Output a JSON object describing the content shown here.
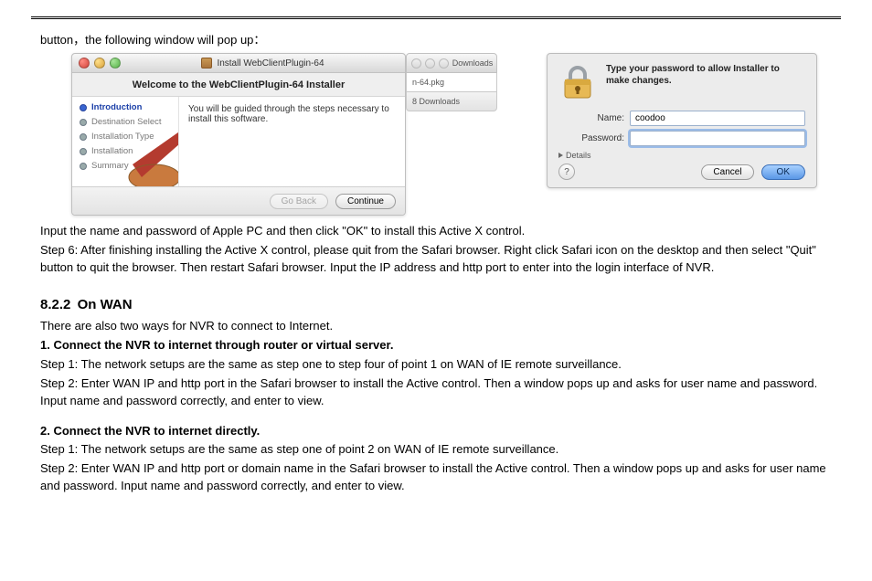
{
  "lead": "button，the following window will pop up：",
  "installer": {
    "title": "Install WebClientPlugin-64",
    "welcome": "Welcome to the WebClientPlugin-64 Installer",
    "steps": [
      "Introduction",
      "Destination Select",
      "Installation Type",
      "Installation",
      "Summary"
    ],
    "guide": "You will be guided through the steps necessary to install this software.",
    "go_back": "Go Back",
    "continue": "Continue"
  },
  "downloads": {
    "title": "Downloads",
    "file": "n-64.pkg",
    "count": "8 Downloads"
  },
  "auth": {
    "prompt": "Type your password to allow Installer to make changes.",
    "name_label": "Name:",
    "name_value": "coodoo",
    "password_label": "Password:",
    "details": "Details",
    "cancel": "Cancel",
    "ok": "OK"
  },
  "para1a": "Input the name and password of Apple PC and then click \"OK\" to install this Active X control.",
  "para1b": "Step 6: After finishing installing the Active X control, please quit from the Safari browser. Right click Safari icon on the desktop and then select \"Quit\" button to quit the browser. Then restart Safari browser. Input the IP address and http port to enter into the login interface of NVR.",
  "section": {
    "num": "8.2.2",
    "title": "On WAN"
  },
  "s_intro": "There are also two ways for NVR to connect to Internet.",
  "m1_title": "1. Connect the NVR to internet through router or virtual server.",
  "m1_s1": "Step 1: The network setups are the same as step one to step four of point 1 on WAN of IE remote surveillance.",
  "m1_s2": "Step 2: Enter WAN IP and http port in the Safari browser to install the Active control. Then a window pops up and asks for user name and password. Input name and password correctly, and enter to view.",
  "m2_title": "2. Connect the NVR to internet directly.",
  "m2_s1": "Step 1: The network setups are the same as step one of point 2 on WAN of IE remote surveillance.",
  "m2_s2": "Step 2: Enter WAN IP and http port or domain name in the Safari browser to install the Active control. Then a window pops up and asks for user name and password. Input name and password correctly, and enter to view."
}
